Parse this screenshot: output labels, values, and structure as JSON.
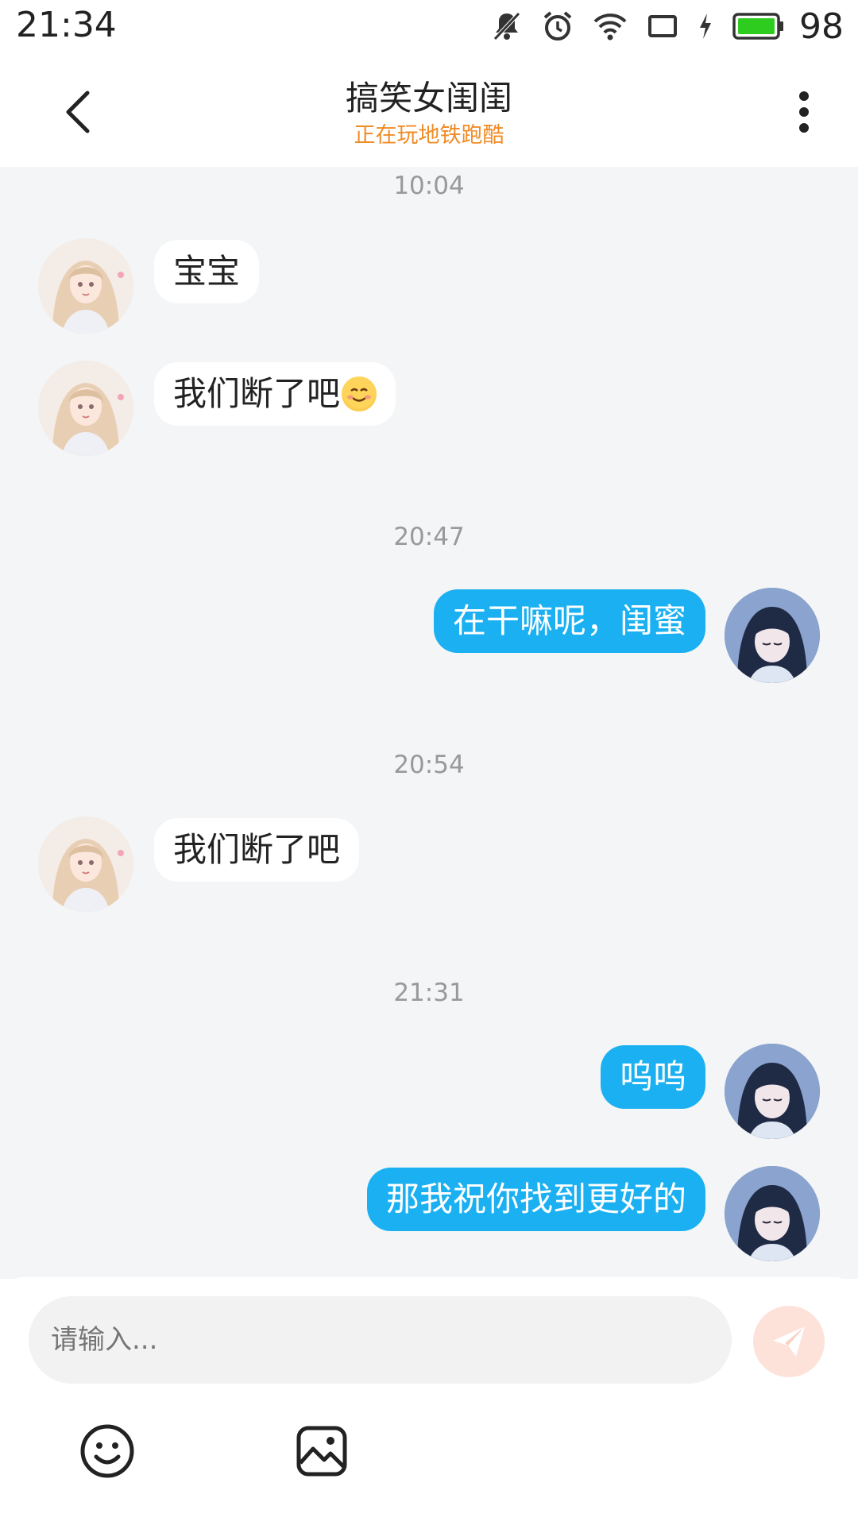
{
  "status_bar": {
    "time": "21:34",
    "battery_percent": "98",
    "icons": [
      "mute-icon",
      "alarm-icon",
      "wifi-icon",
      "screen-icon",
      "charging-icon",
      "battery-icon"
    ]
  },
  "header": {
    "title": "搞笑女闺闺",
    "subtitle": "正在玩地铁跑酷",
    "back_icon": "chevron-left-icon",
    "more_icon": "more-vertical-icon"
  },
  "messages": [
    {
      "type": "timestamp",
      "text": "10:04"
    },
    {
      "type": "incoming",
      "text": "宝宝"
    },
    {
      "type": "incoming",
      "text": "我们断了吧",
      "emoji": "smiling-face-emoji"
    },
    {
      "type": "timestamp",
      "text": "20:47"
    },
    {
      "type": "outgoing",
      "text": "在干嘛呢，闺蜜"
    },
    {
      "type": "timestamp",
      "text": "20:54"
    },
    {
      "type": "incoming",
      "text": "我们断了吧"
    },
    {
      "type": "timestamp",
      "text": "21:31"
    },
    {
      "type": "outgoing",
      "text": "呜呜"
    },
    {
      "type": "outgoing",
      "text": "那我祝你找到更好的"
    }
  ],
  "input": {
    "placeholder": "请输入...",
    "send_icon": "send-icon",
    "emoji_icon": "smiley-icon",
    "image_icon": "image-icon"
  },
  "colors": {
    "outgoing_bubble": "#1ab0f1",
    "incoming_bubble": "#ffffff",
    "subtitle": "#f08c27",
    "chat_bg": "#f3f5f6",
    "send_button": "#fde2da"
  }
}
